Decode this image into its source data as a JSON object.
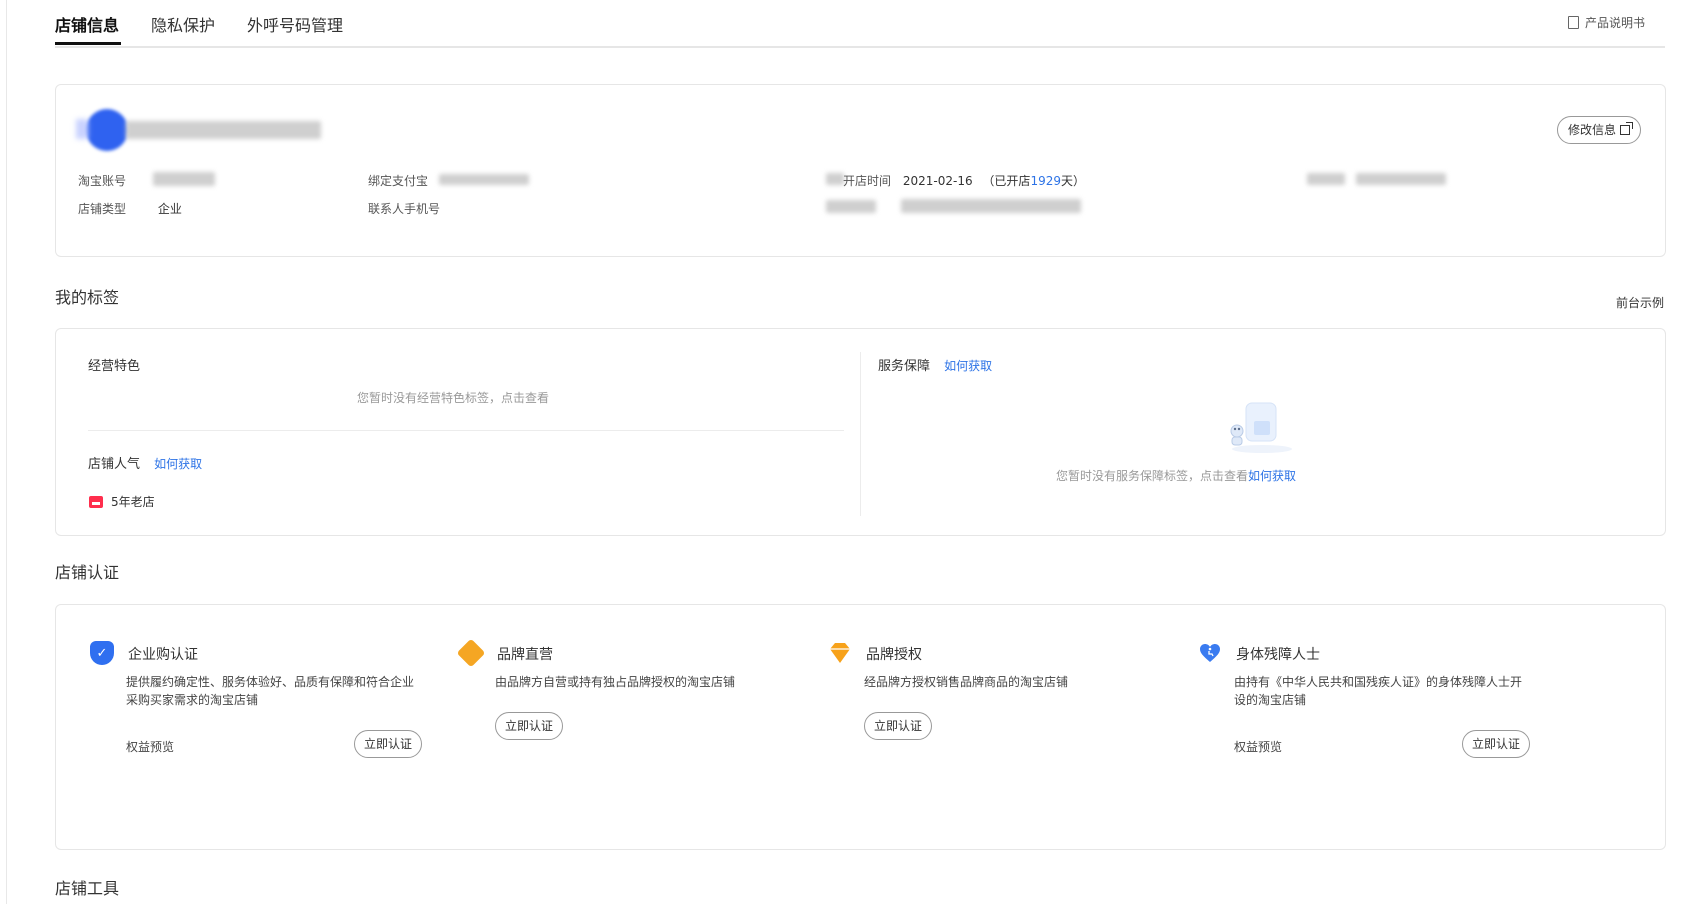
{
  "tabs": {
    "store_info": "店铺信息",
    "privacy": "隐私保护",
    "outbound": "外呼号码管理",
    "manual": "产品说明书"
  },
  "store": {
    "edit_label": "修改信息",
    "taobao_account_label": "淘宝账号",
    "store_type_label": "店铺类型",
    "store_type_value": "企业",
    "alipay_label": "绑定支付宝",
    "contact_phone_label": "联系人手机号",
    "open_time_label": "开店时间",
    "open_date": "2021-02-16",
    "opened_prefix": "（已开店",
    "opened_days": "1929",
    "opened_suffix": "天）"
  },
  "tags": {
    "section_title": "我的标签",
    "preview_link": "前台示例",
    "feature_title": "经营特色",
    "feature_empty": "您暂时没有经营特色标签，点击查看",
    "popularity_title": "店铺人气",
    "how_to_get": "如何获取",
    "badge_label": "5年老店",
    "service_title": "服务保障",
    "service_empty": "您暂时没有服务保障标签，点击查看",
    "service_empty_link": "如何获取"
  },
  "cert": {
    "section_title": "店铺认证",
    "benefit_label": "权益预览",
    "action_label": "立即认证",
    "items": [
      {
        "title": "企业购认证",
        "desc": "提供履约确定性、服务体验好、品质有保障和符合企业采购买家需求的淘宝店铺"
      },
      {
        "title": "品牌直营",
        "desc": "由品牌方自营或持有独占品牌授权的淘宝店铺"
      },
      {
        "title": "品牌授权",
        "desc": "经品牌方授权销售品牌商品的淘宝店铺"
      },
      {
        "title": "身体残障人士",
        "desc": "由持有《中华人民共和国残疾人证》的身体残障人士开设的淘宝店铺"
      }
    ]
  },
  "tools": {
    "section_title": "店铺工具"
  },
  "colors": {
    "link": "#2d73e6",
    "avatar": "#2f62f0",
    "shield": "#2f6ff0",
    "brand_direct": "#f5a623",
    "brand_auth": "#f7a21b",
    "disability": "#3a7bf0",
    "badge": "#ff2e4d"
  }
}
